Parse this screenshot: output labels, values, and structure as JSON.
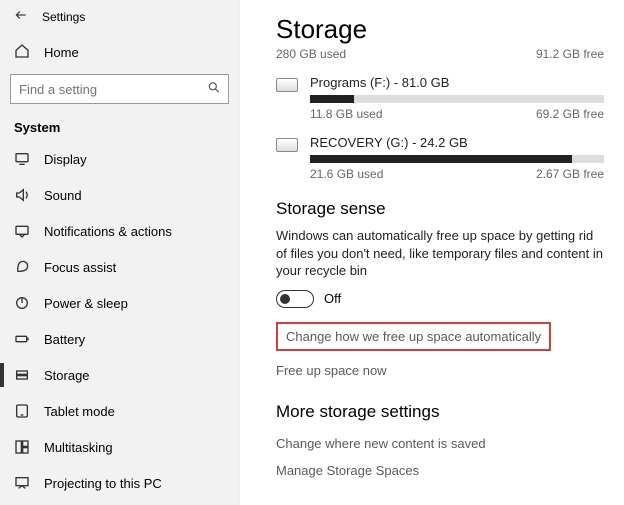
{
  "header": {
    "back_aria": "Back",
    "title": "Settings"
  },
  "home": {
    "label": "Home"
  },
  "search": {
    "placeholder": "Find a setting"
  },
  "category": "System",
  "nav": [
    {
      "id": "display",
      "label": "Display"
    },
    {
      "id": "sound",
      "label": "Sound"
    },
    {
      "id": "notifications",
      "label": "Notifications & actions"
    },
    {
      "id": "focus",
      "label": "Focus assist"
    },
    {
      "id": "power",
      "label": "Power & sleep"
    },
    {
      "id": "battery",
      "label": "Battery"
    },
    {
      "id": "storage",
      "label": "Storage",
      "active": true
    },
    {
      "id": "tablet",
      "label": "Tablet mode"
    },
    {
      "id": "multitasking",
      "label": "Multitasking"
    },
    {
      "id": "projecting",
      "label": "Projecting to this PC"
    }
  ],
  "storage": {
    "title": "Storage",
    "used": "280 GB used",
    "free": "91.2 GB free",
    "drives": [
      {
        "title": "Programs (F:) - 81.0 GB",
        "used": "11.8 GB used",
        "free": "69.2 GB free",
        "pct": 15
      },
      {
        "title": "RECOVERY (G:) - 24.2 GB",
        "used": "21.6 GB used",
        "free": "2.67 GB free",
        "pct": 89
      }
    ]
  },
  "sense": {
    "heading": "Storage sense",
    "body": "Windows can automatically free up space by getting rid of files you don't need, like temporary files and content in your recycle bin",
    "toggle_state": "Off",
    "change_link": "Change how we free up space automatically",
    "free_link": "Free up space now"
  },
  "more": {
    "heading": "More storage settings",
    "change_where": "Change where new content is saved",
    "manage_spaces": "Manage Storage Spaces"
  }
}
